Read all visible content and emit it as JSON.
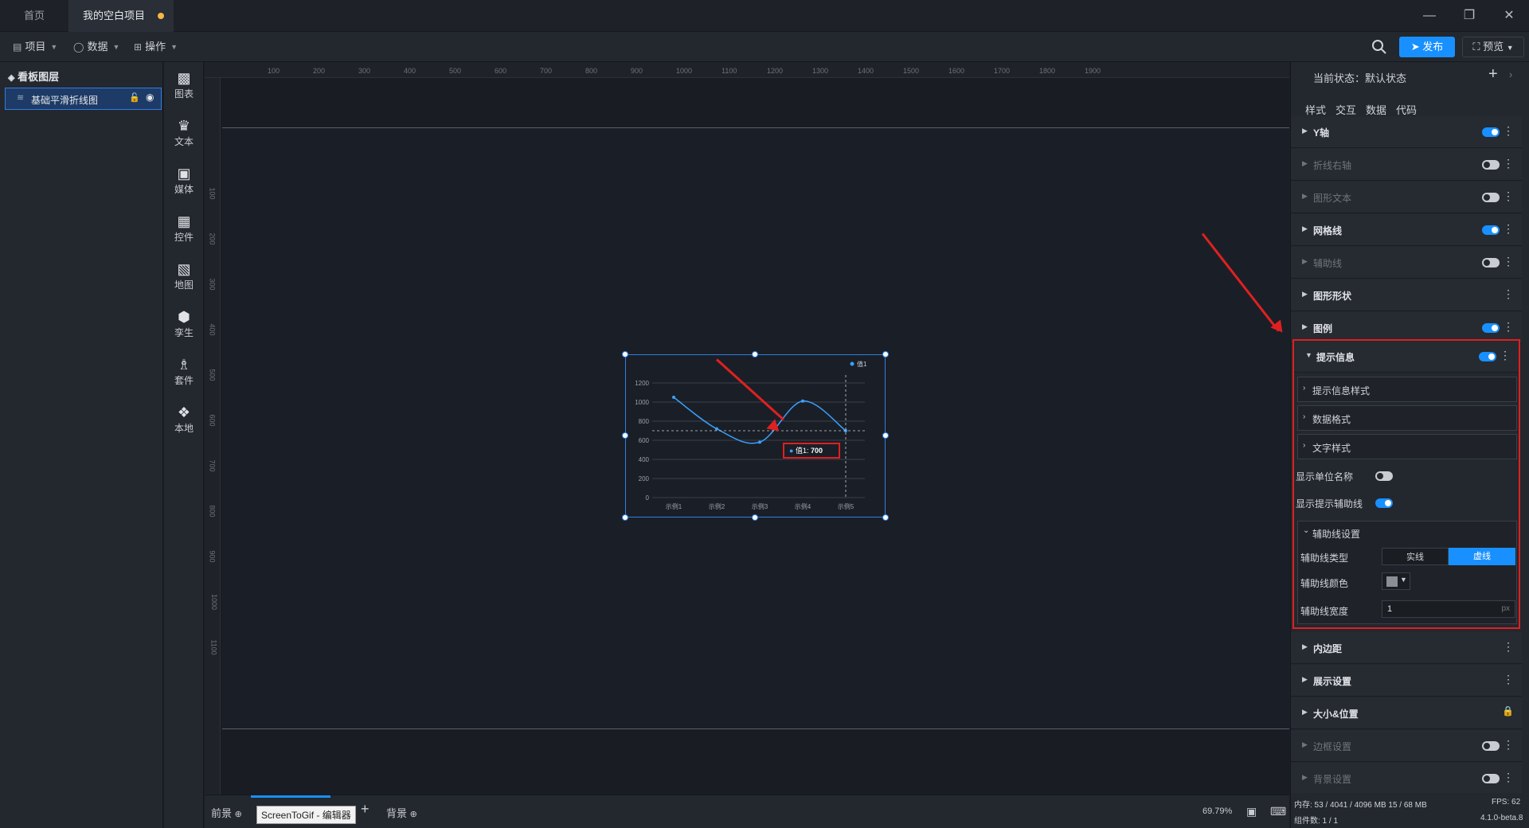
{
  "titlebar": {
    "tabs": [
      "首页",
      "我的空白项目"
    ],
    "unsaved_indicator_color": "#f5b942"
  },
  "menubar": {
    "items": [
      {
        "label": "项目",
        "icon": "file-icon"
      },
      {
        "label": "数据",
        "icon": "database-icon"
      },
      {
        "label": "操作",
        "icon": "grid-icon"
      }
    ],
    "publish_label": "发布",
    "preview_label": "预览"
  },
  "layers": {
    "title": "看板图层",
    "items": [
      {
        "label": "基础平滑折线图"
      }
    ]
  },
  "components": [
    "图表",
    "文本",
    "媒体",
    "控件",
    "地图",
    "孪生",
    "套件",
    "本地"
  ],
  "ruler": {
    "top": [
      "100",
      "200",
      "300",
      "400",
      "500",
      "600",
      "700",
      "800",
      "900",
      "1000",
      "1100",
      "1200",
      "1300",
      "1400",
      "1500",
      "1600",
      "1700",
      "1800",
      "1900"
    ],
    "left": [
      "100",
      "200",
      "300",
      "400",
      "500",
      "600",
      "700",
      "800",
      "900",
      "1000",
      "1100"
    ]
  },
  "chart_data": {
    "type": "line",
    "categories": [
      "示例1",
      "示例2",
      "示例3",
      "示例4",
      "示例5"
    ],
    "series": [
      {
        "name": "值1",
        "values": [
          1050,
          720,
          580,
          1010,
          700
        ]
      }
    ],
    "yticks": [
      "1200",
      "1000",
      "800",
      "600",
      "400",
      "200",
      "0"
    ],
    "ylim": [
      0,
      1200
    ],
    "legend_position": "top-right",
    "tooltip": {
      "label": "值1:",
      "value": "700"
    },
    "line_color": "#3aa0ff"
  },
  "bottom": {
    "tabs": [
      "前景",
      "背景"
    ],
    "tooltip": "ScreenToGif - 编辑器",
    "zoom": "69.79%"
  },
  "props": {
    "state": "当前状态：默认状态",
    "tabs": [
      "样式",
      "交互",
      "数据",
      "代码"
    ],
    "sections_top": [
      {
        "label": "Y轴",
        "toggle": true,
        "dim": false
      },
      {
        "label": "折线右轴",
        "toggle": false,
        "dim": true
      },
      {
        "label": "图形文本",
        "toggle": false,
        "dim": true
      },
      {
        "label": "网格线",
        "toggle": true,
        "dim": false
      },
      {
        "label": "辅助线",
        "toggle": false,
        "dim": true
      },
      {
        "label": "图形形状",
        "toggle": null,
        "dim": false
      },
      {
        "label": "图例",
        "toggle": true,
        "dim": false
      }
    ],
    "tip_section": {
      "label": "提示信息",
      "subsections": [
        "提示信息样式",
        "数据格式",
        "文字样式"
      ],
      "show_unit_label": "显示单位名称",
      "show_guide_label": "显示提示辅助线",
      "guide_settings_label": "辅助线设置",
      "guide_type_label": "辅助线类型",
      "guide_type_options": [
        "实线",
        "虚线"
      ],
      "guide_color_label": "辅助线颜色",
      "guide_width_label": "辅助线宽度",
      "guide_width_value": "1",
      "guide_width_unit": "px"
    },
    "sections_bottom": [
      {
        "label": "内边距",
        "toggle": null,
        "dim": false
      },
      {
        "label": "展示设置",
        "toggle": null,
        "dim": false
      },
      {
        "label": "大小&位置",
        "toggle": null,
        "dim": false,
        "lock": true
      },
      {
        "label": "边框设置",
        "toggle": false,
        "dim": true
      },
      {
        "label": "背景设置",
        "toggle": false,
        "dim": true
      }
    ],
    "status": {
      "memory": "内存:  53 / 4041 / 4096 MB  15 / 68 MB",
      "fps": "FPS:  62",
      "components": "组件数: 1 / 1",
      "version": "4.1.0-beta.8"
    }
  }
}
